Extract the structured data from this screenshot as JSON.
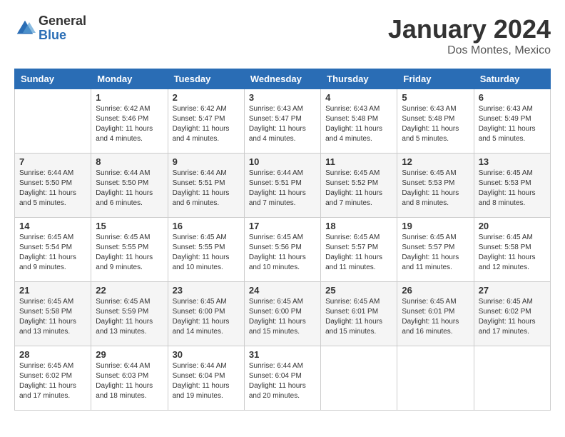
{
  "logo": {
    "general": "General",
    "blue": "Blue"
  },
  "title": {
    "month": "January 2024",
    "location": "Dos Montes, Mexico"
  },
  "calendar": {
    "headers": [
      "Sunday",
      "Monday",
      "Tuesday",
      "Wednesday",
      "Thursday",
      "Friday",
      "Saturday"
    ],
    "weeks": [
      [
        {
          "day": "",
          "sunrise": "",
          "sunset": "",
          "daylight": ""
        },
        {
          "day": "1",
          "sunrise": "Sunrise: 6:42 AM",
          "sunset": "Sunset: 5:46 PM",
          "daylight": "Daylight: 11 hours and 4 minutes."
        },
        {
          "day": "2",
          "sunrise": "Sunrise: 6:42 AM",
          "sunset": "Sunset: 5:47 PM",
          "daylight": "Daylight: 11 hours and 4 minutes."
        },
        {
          "day": "3",
          "sunrise": "Sunrise: 6:43 AM",
          "sunset": "Sunset: 5:47 PM",
          "daylight": "Daylight: 11 hours and 4 minutes."
        },
        {
          "day": "4",
          "sunrise": "Sunrise: 6:43 AM",
          "sunset": "Sunset: 5:48 PM",
          "daylight": "Daylight: 11 hours and 4 minutes."
        },
        {
          "day": "5",
          "sunrise": "Sunrise: 6:43 AM",
          "sunset": "Sunset: 5:48 PM",
          "daylight": "Daylight: 11 hours and 5 minutes."
        },
        {
          "day": "6",
          "sunrise": "Sunrise: 6:43 AM",
          "sunset": "Sunset: 5:49 PM",
          "daylight": "Daylight: 11 hours and 5 minutes."
        }
      ],
      [
        {
          "day": "7",
          "sunrise": "Sunrise: 6:44 AM",
          "sunset": "Sunset: 5:50 PM",
          "daylight": "Daylight: 11 hours and 5 minutes."
        },
        {
          "day": "8",
          "sunrise": "Sunrise: 6:44 AM",
          "sunset": "Sunset: 5:50 PM",
          "daylight": "Daylight: 11 hours and 6 minutes."
        },
        {
          "day": "9",
          "sunrise": "Sunrise: 6:44 AM",
          "sunset": "Sunset: 5:51 PM",
          "daylight": "Daylight: 11 hours and 6 minutes."
        },
        {
          "day": "10",
          "sunrise": "Sunrise: 6:44 AM",
          "sunset": "Sunset: 5:51 PM",
          "daylight": "Daylight: 11 hours and 7 minutes."
        },
        {
          "day": "11",
          "sunrise": "Sunrise: 6:45 AM",
          "sunset": "Sunset: 5:52 PM",
          "daylight": "Daylight: 11 hours and 7 minutes."
        },
        {
          "day": "12",
          "sunrise": "Sunrise: 6:45 AM",
          "sunset": "Sunset: 5:53 PM",
          "daylight": "Daylight: 11 hours and 8 minutes."
        },
        {
          "day": "13",
          "sunrise": "Sunrise: 6:45 AM",
          "sunset": "Sunset: 5:53 PM",
          "daylight": "Daylight: 11 hours and 8 minutes."
        }
      ],
      [
        {
          "day": "14",
          "sunrise": "Sunrise: 6:45 AM",
          "sunset": "Sunset: 5:54 PM",
          "daylight": "Daylight: 11 hours and 9 minutes."
        },
        {
          "day": "15",
          "sunrise": "Sunrise: 6:45 AM",
          "sunset": "Sunset: 5:55 PM",
          "daylight": "Daylight: 11 hours and 9 minutes."
        },
        {
          "day": "16",
          "sunrise": "Sunrise: 6:45 AM",
          "sunset": "Sunset: 5:55 PM",
          "daylight": "Daylight: 11 hours and 10 minutes."
        },
        {
          "day": "17",
          "sunrise": "Sunrise: 6:45 AM",
          "sunset": "Sunset: 5:56 PM",
          "daylight": "Daylight: 11 hours and 10 minutes."
        },
        {
          "day": "18",
          "sunrise": "Sunrise: 6:45 AM",
          "sunset": "Sunset: 5:57 PM",
          "daylight": "Daylight: 11 hours and 11 minutes."
        },
        {
          "day": "19",
          "sunrise": "Sunrise: 6:45 AM",
          "sunset": "Sunset: 5:57 PM",
          "daylight": "Daylight: 11 hours and 11 minutes."
        },
        {
          "day": "20",
          "sunrise": "Sunrise: 6:45 AM",
          "sunset": "Sunset: 5:58 PM",
          "daylight": "Daylight: 11 hours and 12 minutes."
        }
      ],
      [
        {
          "day": "21",
          "sunrise": "Sunrise: 6:45 AM",
          "sunset": "Sunset: 5:58 PM",
          "daylight": "Daylight: 11 hours and 13 minutes."
        },
        {
          "day": "22",
          "sunrise": "Sunrise: 6:45 AM",
          "sunset": "Sunset: 5:59 PM",
          "daylight": "Daylight: 11 hours and 13 minutes."
        },
        {
          "day": "23",
          "sunrise": "Sunrise: 6:45 AM",
          "sunset": "Sunset: 6:00 PM",
          "daylight": "Daylight: 11 hours and 14 minutes."
        },
        {
          "day": "24",
          "sunrise": "Sunrise: 6:45 AM",
          "sunset": "Sunset: 6:00 PM",
          "daylight": "Daylight: 11 hours and 15 minutes."
        },
        {
          "day": "25",
          "sunrise": "Sunrise: 6:45 AM",
          "sunset": "Sunset: 6:01 PM",
          "daylight": "Daylight: 11 hours and 15 minutes."
        },
        {
          "day": "26",
          "sunrise": "Sunrise: 6:45 AM",
          "sunset": "Sunset: 6:01 PM",
          "daylight": "Daylight: 11 hours and 16 minutes."
        },
        {
          "day": "27",
          "sunrise": "Sunrise: 6:45 AM",
          "sunset": "Sunset: 6:02 PM",
          "daylight": "Daylight: 11 hours and 17 minutes."
        }
      ],
      [
        {
          "day": "28",
          "sunrise": "Sunrise: 6:45 AM",
          "sunset": "Sunset: 6:02 PM",
          "daylight": "Daylight: 11 hours and 17 minutes."
        },
        {
          "day": "29",
          "sunrise": "Sunrise: 6:44 AM",
          "sunset": "Sunset: 6:03 PM",
          "daylight": "Daylight: 11 hours and 18 minutes."
        },
        {
          "day": "30",
          "sunrise": "Sunrise: 6:44 AM",
          "sunset": "Sunset: 6:04 PM",
          "daylight": "Daylight: 11 hours and 19 minutes."
        },
        {
          "day": "31",
          "sunrise": "Sunrise: 6:44 AM",
          "sunset": "Sunset: 6:04 PM",
          "daylight": "Daylight: 11 hours and 20 minutes."
        },
        {
          "day": "",
          "sunrise": "",
          "sunset": "",
          "daylight": ""
        },
        {
          "day": "",
          "sunrise": "",
          "sunset": "",
          "daylight": ""
        },
        {
          "day": "",
          "sunrise": "",
          "sunset": "",
          "daylight": ""
        }
      ]
    ]
  }
}
